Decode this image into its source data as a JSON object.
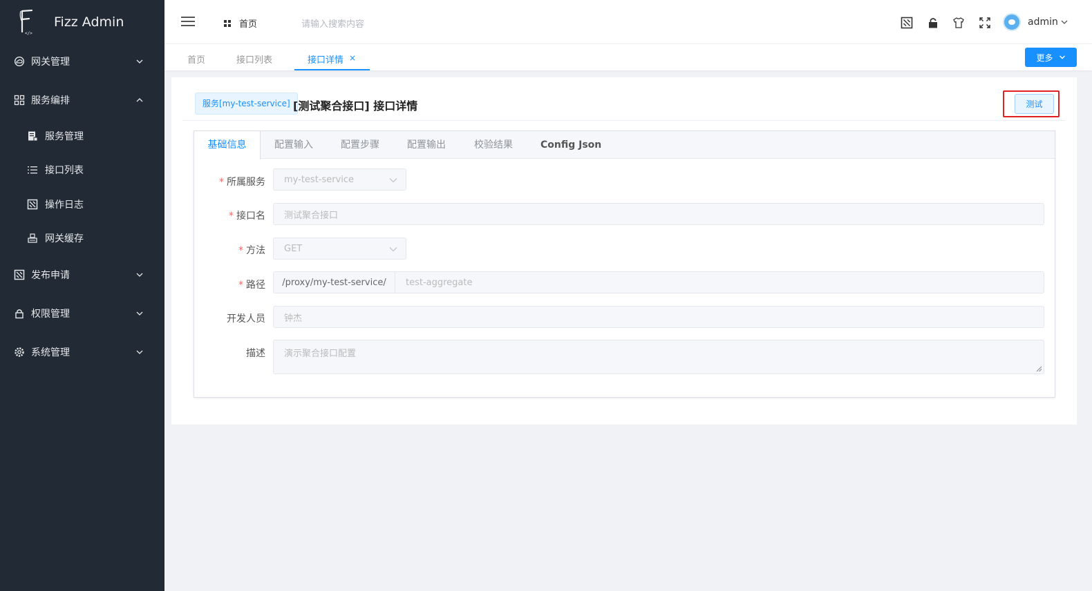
{
  "app": {
    "name": "Fizz Admin"
  },
  "sidebar": {
    "items": [
      {
        "label": "网关管理",
        "icon": "cloud-icon",
        "expanded": false
      },
      {
        "label": "服务编排",
        "icon": "grid-icon",
        "expanded": true,
        "children": [
          {
            "label": "服务管理",
            "icon": "server-doc-icon"
          },
          {
            "label": "接口列表",
            "icon": "list-icon"
          },
          {
            "label": "操作日志",
            "icon": "log-icon"
          },
          {
            "label": "网关缓存",
            "icon": "cache-icon"
          }
        ]
      },
      {
        "label": "发布申请",
        "icon": "publish-icon",
        "expanded": false
      },
      {
        "label": "权限管理",
        "icon": "lock-icon",
        "expanded": false
      },
      {
        "label": "系统管理",
        "icon": "gear-icon",
        "expanded": false
      }
    ]
  },
  "header": {
    "home_label": "首页",
    "search_placeholder": "请输入搜索内容",
    "username": "admin",
    "icons": [
      "publish-icon",
      "lock-icon",
      "shirt-icon",
      "fullscreen-icon"
    ]
  },
  "page_tabs": {
    "tabs": [
      "首页",
      "接口列表",
      "接口详情"
    ],
    "active_index": 2,
    "more_label": "更多"
  },
  "detail": {
    "service_tag": "服务[my-test-service]",
    "title": "[测试聚合接口] 接口详情",
    "test_button": "测试",
    "tabs": [
      "基础信息",
      "配置输入",
      "配置步骤",
      "配置输出",
      "校验结果",
      "Config Json"
    ],
    "active_tab": 0,
    "form": {
      "service_label": "所属服务",
      "service_value": "my-test-service",
      "name_label": "接口名",
      "name_value": "测试聚合接口",
      "method_label": "方法",
      "method_value": "GET",
      "path_label": "路径",
      "path_prefix": "/proxy/my-test-service/",
      "path_value": "test-aggregate",
      "developer_label": "开发人员",
      "developer_value": "钟杰",
      "desc_label": "描述",
      "desc_value": "演示聚合接口配置"
    }
  },
  "colors": {
    "sidebar_bg": "#222a35",
    "primary": "#1890ff",
    "highlight_frame": "#e02020",
    "required": "#f56c6c"
  }
}
